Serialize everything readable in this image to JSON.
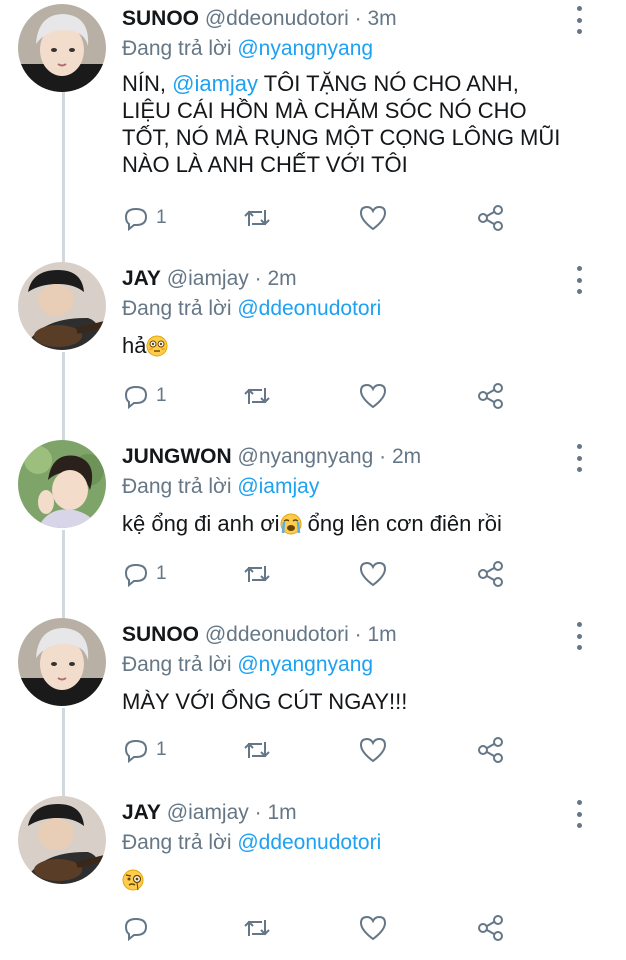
{
  "reply_prefix": "Đang trả lời",
  "tweets": [
    {
      "name": "SUNOO",
      "handle": "@ddeonudotori",
      "time": "· 3m",
      "reply_to": "@nyangnyang",
      "body_lines": [
        {
          "pre": "NÍN, ",
          "mention": "@iamjay",
          "post": " TÔI TẶNG NÓ CHO ANH,"
        },
        "LIỆU CÁI HỒN MÀ CHĂM SÓC NÓ CHO",
        "TỐT, NÓ MÀ RỤNG MỘT CỌNG LÔNG MŨI",
        "NÀO LÀ ANH CHẾT VỚI TÔI"
      ],
      "reply_count": "1"
    },
    {
      "name": "JAY",
      "handle": "@iamjay",
      "time": "· 2m",
      "reply_to": "@ddeonudotori",
      "body_text": "hả",
      "emoji": "flushed-face",
      "reply_count": "1"
    },
    {
      "name": "JUNGWON",
      "handle": "@nyangnyang",
      "time": "· 2m",
      "reply_to": "@iamjay",
      "body_text_pre": "kệ ổng đi anh ơi",
      "emoji": "crying-face",
      "body_text_post": " ổng lên cơn điên rồi",
      "reply_count": "1"
    },
    {
      "name": "SUNOO",
      "handle": "@ddeonudotori",
      "time": "· 1m",
      "reply_to": "@nyangnyang",
      "body_text": "MÀY VỚI ỔNG CÚT NGAY!!!",
      "reply_count": "1"
    },
    {
      "name": "JAY",
      "handle": "@iamjay",
      "time": "· 1m",
      "reply_to": "@ddeonudotori",
      "emoji": "face-with-monocle",
      "reply_count": ""
    }
  ],
  "colors": {
    "link": "#1da1f2",
    "secondary": "#657786",
    "text": "#14171a",
    "thread_line": "#cfd9de"
  }
}
